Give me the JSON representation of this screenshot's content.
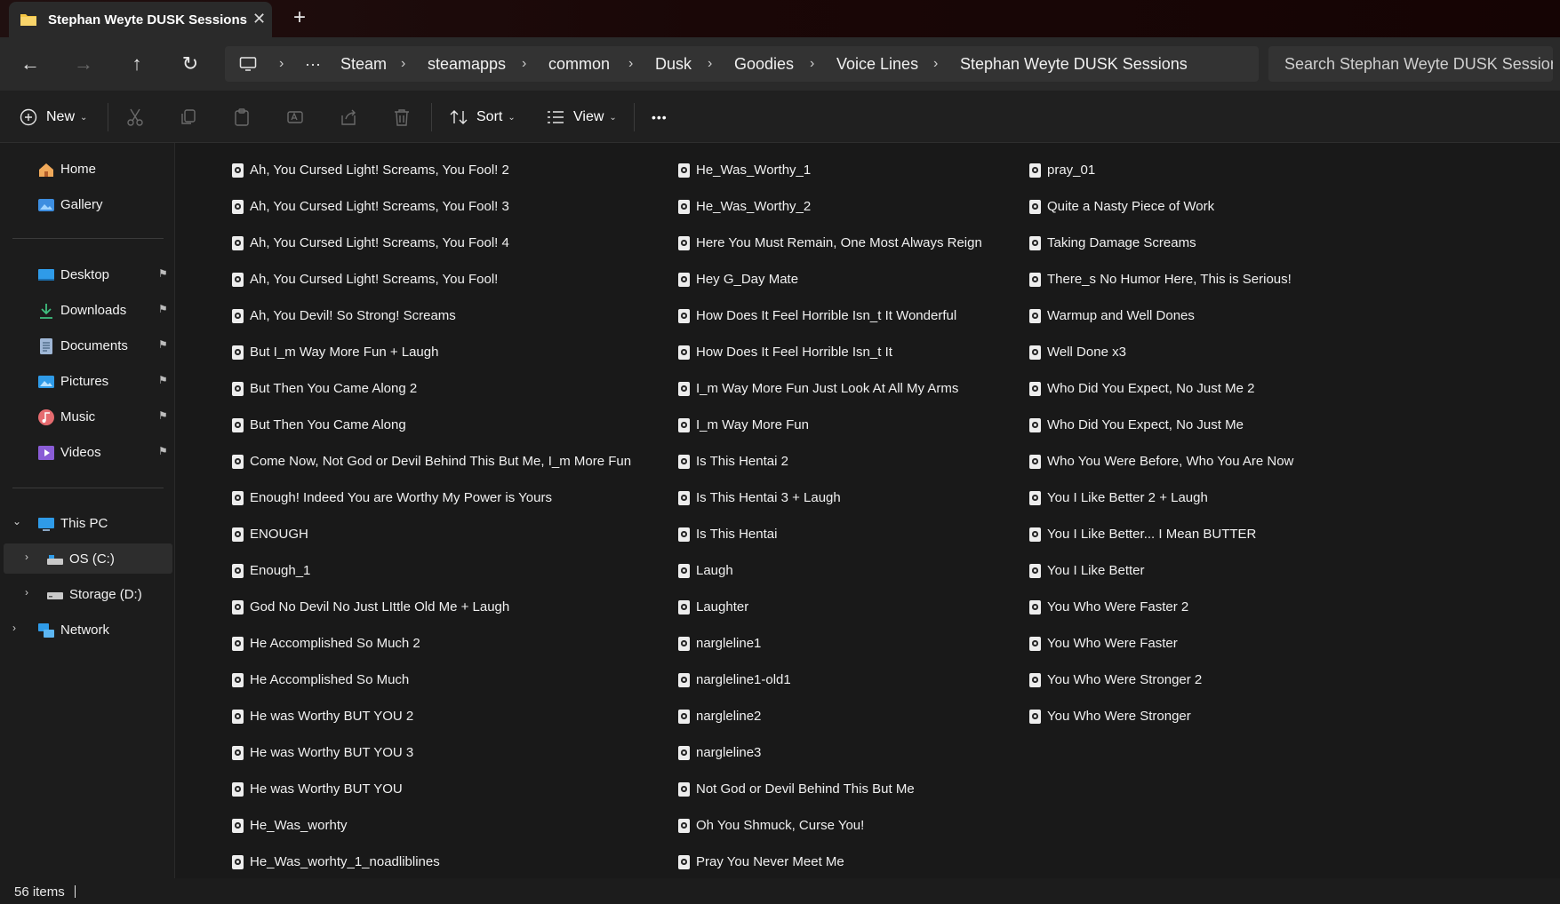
{
  "tab": {
    "title": "Stephan Weyte DUSK Sessions",
    "close": "✕",
    "new_tab": "+"
  },
  "nav": {
    "back": "←",
    "forward": "→",
    "up": "↑",
    "refresh": "↻"
  },
  "breadcrumb": {
    "more": "···",
    "items": [
      "Steam",
      "steamapps",
      "common",
      "Dusk",
      "Goodies",
      "Voice Lines",
      "Stephan Weyte DUSK Sessions"
    ],
    "separator": "›"
  },
  "search": {
    "placeholder": "Search Stephan Weyte DUSK Sessions"
  },
  "toolbar": {
    "new_label": "New",
    "sort_label": "Sort",
    "view_label": "View",
    "more_label": "•••"
  },
  "sidebar": {
    "quick": [
      {
        "label": "Home",
        "icon": "home-icon"
      },
      {
        "label": "Gallery",
        "icon": "gallery-icon"
      }
    ],
    "pinned": [
      {
        "label": "Desktop",
        "icon": "desktop-icon"
      },
      {
        "label": "Downloads",
        "icon": "downloads-icon"
      },
      {
        "label": "Documents",
        "icon": "documents-icon"
      },
      {
        "label": "Pictures",
        "icon": "pictures-icon"
      },
      {
        "label": "Music",
        "icon": "music-icon"
      },
      {
        "label": "Videos",
        "icon": "videos-icon"
      }
    ],
    "this_pc": "This PC",
    "drives": [
      "OS (C:)",
      "Storage (D:)"
    ],
    "network": "Network",
    "pin_glyph": "📌"
  },
  "files": {
    "col1": [
      "Ah, You Cursed Light! Screams, You Fool! 2",
      "Ah, You Cursed Light! Screams, You Fool! 3",
      "Ah, You Cursed Light! Screams, You Fool! 4",
      "Ah, You Cursed Light! Screams, You Fool!",
      "Ah, You Devil! So Strong! Screams",
      "But I_m Way More Fun + Laugh",
      "But Then You Came Along 2",
      "But Then You Came Along",
      "Come Now, Not God or Devil Behind This But Me, I_m More Fun",
      "Enough! Indeed You are Worthy My Power is Yours",
      "ENOUGH",
      "Enough_1",
      "God No Devil No Just LIttle Old Me + Laugh",
      "He Accomplished So Much 2",
      "He Accomplished So Much",
      "He was Worthy BUT YOU 2",
      "He was Worthy BUT YOU 3",
      "He was Worthy BUT YOU",
      "He_Was_worhty",
      "He_Was_worhty_1_noadliblines"
    ],
    "col2": [
      "He_Was_Worthy_1",
      "He_Was_Worthy_2",
      "Here You Must Remain, One Most Always Reign",
      "Hey G_Day Mate",
      "How Does It Feel Horrible Isn_t It Wonderful",
      "How Does It Feel Horrible Isn_t It",
      "I_m Way More Fun Just Look At All My Arms",
      "I_m Way More Fun",
      "Is This Hentai 2",
      "Is This Hentai 3 + Laugh",
      "Is This Hentai",
      "Laugh",
      "Laughter",
      "nargleline1",
      "nargleline1-old1",
      "nargleline2",
      "nargleline3",
      "Not God or Devil Behind This But Me",
      "Oh You Shmuck, Curse You!",
      "Pray You Never Meet Me"
    ],
    "col3": [
      "pray_01",
      "Quite a Nasty Piece of Work",
      "Taking Damage Screams",
      "There_s No Humor Here, This is Serious!",
      "Warmup and Well Dones",
      "Well Done x3",
      "Who Did You Expect, No Just Me 2",
      "Who Did You Expect, No Just Me",
      "Who You Were Before, Who You Are Now",
      "You I Like Better 2 + Laugh",
      "You I Like Better... I Mean BUTTER",
      "You I Like Better",
      "You Who Were Faster 2",
      "You Who Were Faster",
      "You Who Were Stronger 2",
      "You Who Were Stronger"
    ]
  },
  "status": {
    "count": "56 items"
  },
  "colors": {
    "accent": "#4cc2ff",
    "folder": "#f4c542",
    "titlebar": "#1a0707"
  }
}
